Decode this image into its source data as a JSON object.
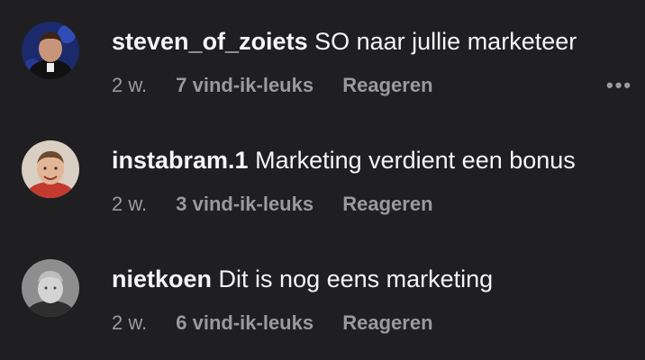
{
  "comments": [
    {
      "username": "steven_of_zoiets",
      "text": "SO naar jullie marketeer",
      "time": "2 w.",
      "likes": "7 vind-ik-leuks",
      "reply": "Reageren",
      "more": "•••"
    },
    {
      "username": "instabram.1",
      "text": "Marketing verdient een bonus",
      "time": "2 w.",
      "likes": "3 vind-ik-leuks",
      "reply": "Reageren"
    },
    {
      "username": "nietkoen",
      "text": "Dit is nog eens marketing",
      "time": "2 w.",
      "likes": "6 vind-ik-leuks",
      "reply": "Reageren"
    }
  ],
  "colors": {
    "background": "#1f1f22",
    "primary_text": "#f5f5f5",
    "secondary_text": "#9a9a9e"
  }
}
